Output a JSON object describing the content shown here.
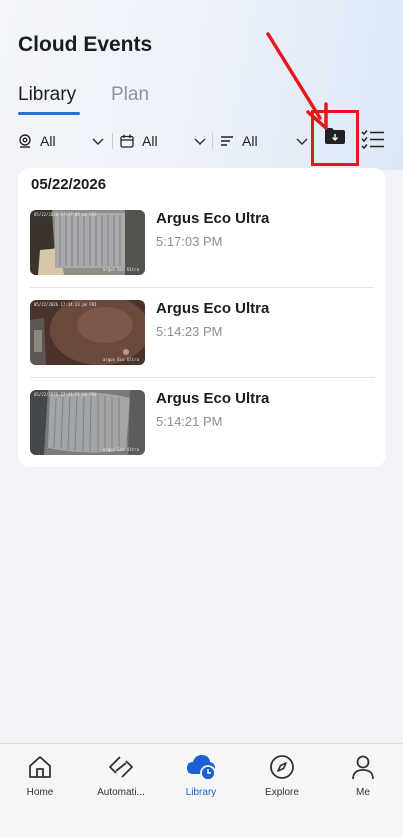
{
  "header": {
    "title": "Cloud Events"
  },
  "tabs": [
    {
      "label": "Library",
      "active": true
    },
    {
      "label": "Plan",
      "active": false
    }
  ],
  "filters": [
    {
      "icon": "camera-icon",
      "value": "All"
    },
    {
      "icon": "calendar-icon",
      "value": "All"
    },
    {
      "icon": "sort-icon",
      "value": "All"
    }
  ],
  "toolbar": {
    "download_icon": "folder-download-icon",
    "select_icon": "checklist-icon"
  },
  "events": {
    "date": "05/22/2026",
    "items": [
      {
        "name": "Argus Eco Ultra",
        "time": "5:17:03 PM",
        "stamp": "05/22/2026 17:17:03 pm FRI",
        "brand": "argus Eco Ultra"
      },
      {
        "name": "Argus Eco Ultra",
        "time": "5:14:23 PM",
        "stamp": "05/22/2026 17:14:23 pm FRI",
        "brand": "argus Eco Ultra"
      },
      {
        "name": "Argus Eco Ultra",
        "time": "5:14:21 PM",
        "stamp": "05/22/2026 17:14:21 pm FRI",
        "brand": "argus Eco Ultra"
      }
    ]
  },
  "tabbar": [
    {
      "label": "Home",
      "icon": "home-icon",
      "active": false
    },
    {
      "label": "Automati...",
      "icon": "automation-icon",
      "active": false
    },
    {
      "label": "Library",
      "icon": "cloud-clock-icon",
      "active": true
    },
    {
      "label": "Explore",
      "icon": "compass-icon",
      "active": false
    },
    {
      "label": "Me",
      "icon": "person-icon",
      "active": false
    }
  ],
  "colors": {
    "accent": "#2d6fd6",
    "highlight": "#e6171a",
    "active_tab": "#1d5fd1"
  }
}
